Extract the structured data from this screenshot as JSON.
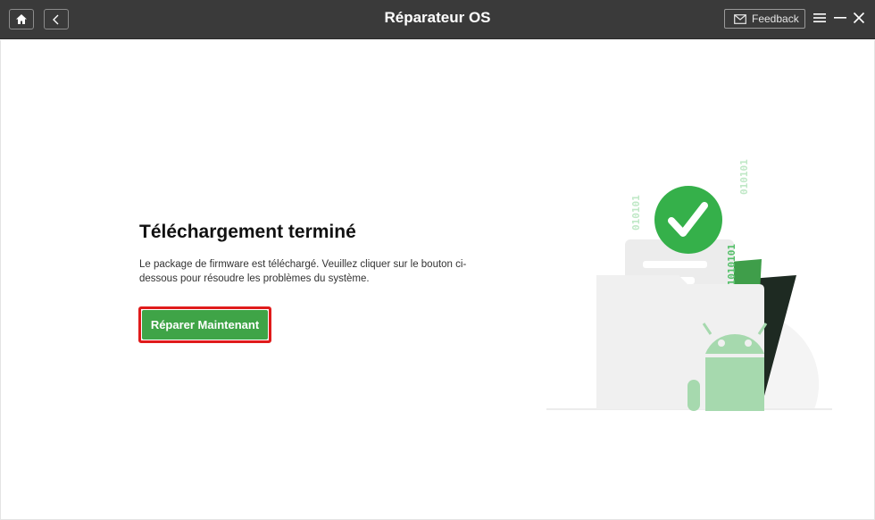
{
  "titlebar": {
    "title": "Réparateur OS",
    "feedback_label": "Feedback"
  },
  "main": {
    "heading": "Téléchargement terminé",
    "description": "Le package de firmware est téléchargé. Veuillez cliquer sur le bouton ci-dessous pour résoudre les problèmes du système.",
    "repair_button_label": "Réparer Maintenant"
  },
  "illustration": {
    "binary_left": "010101",
    "binary_right": "010101",
    "binary_center": "01010101"
  },
  "icons": [
    "home-icon",
    "back-icon",
    "mail-icon",
    "menu-icon",
    "minimize-icon",
    "close-icon",
    "check-icon",
    "android-icon"
  ],
  "colors": {
    "titlebar": "#3a3a3a",
    "accent_green": "#3fa447",
    "highlight_red": "#e01b1b",
    "check_green": "#35b04a"
  }
}
